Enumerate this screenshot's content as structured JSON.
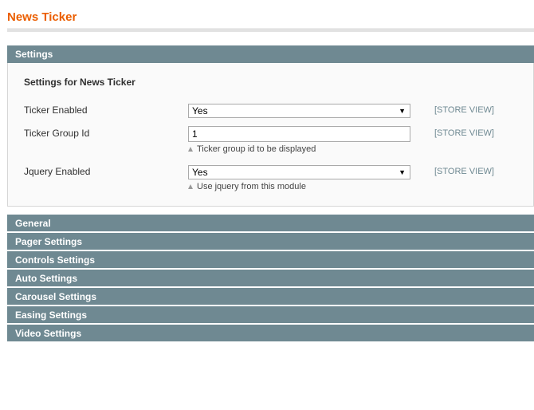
{
  "page": {
    "title": "News Ticker"
  },
  "settings": {
    "header": "Settings",
    "legend": "Settings for News Ticker",
    "fields": [
      {
        "label": "Ticker Enabled",
        "type": "select",
        "value": "Yes",
        "scope": "[STORE VIEW]"
      },
      {
        "label": "Ticker Group Id",
        "type": "text",
        "value": "1",
        "note": "Ticker group id to be displayed",
        "scope": "[STORE VIEW]"
      },
      {
        "label": "Jquery Enabled",
        "type": "select",
        "value": "Yes",
        "note": "Use jquery from this module",
        "scope": "[STORE VIEW]"
      }
    ]
  },
  "sections": [
    {
      "label": "General"
    },
    {
      "label": "Pager Settings"
    },
    {
      "label": "Controls Settings"
    },
    {
      "label": "Auto Settings"
    },
    {
      "label": "Carousel Settings"
    },
    {
      "label": "Easing Settings"
    },
    {
      "label": "Video Settings"
    }
  ],
  "colors": {
    "title": "#eb5e00",
    "section_header": "#6f8992",
    "scope_text": "#6f8992"
  }
}
